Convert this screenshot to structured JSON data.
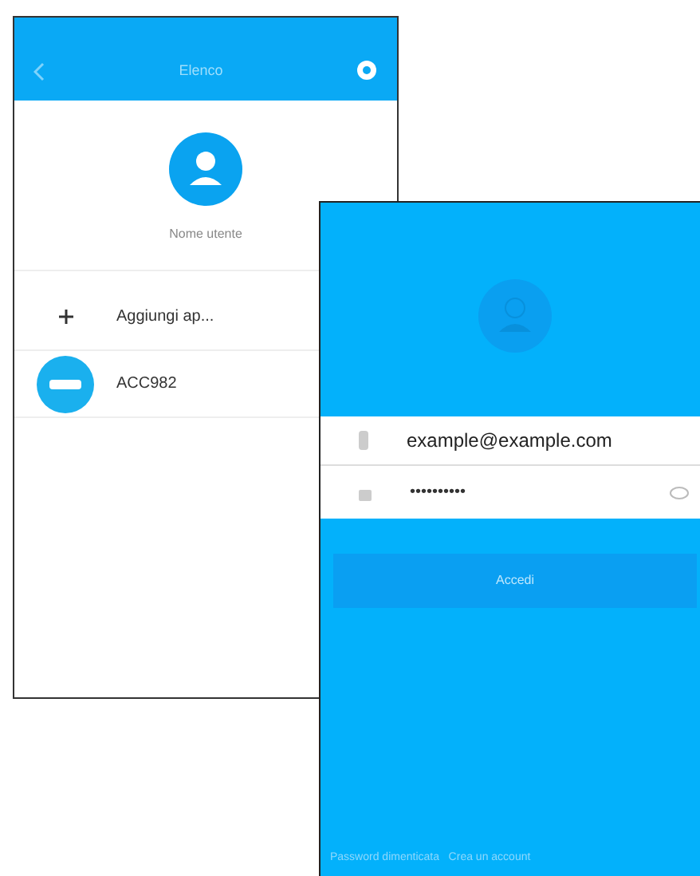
{
  "back_screen": {
    "title": "Elenco",
    "user_name": "Nome utente",
    "items": [
      {
        "kind": "add",
        "label": "Aggiungi ap..."
      },
      {
        "kind": "device",
        "label": "ACC982"
      }
    ]
  },
  "front_screen": {
    "email": {
      "value": "example@example.com"
    },
    "password": {
      "value": "••••••••••"
    },
    "login_button": "Accedi",
    "footer": "Password dimenticata   Crea un account"
  }
}
